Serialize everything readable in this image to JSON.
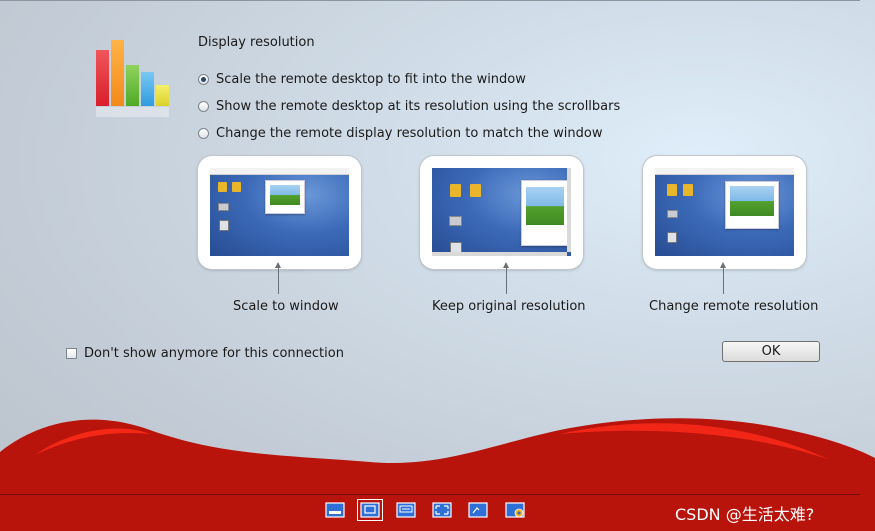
{
  "heading": "Display resolution",
  "options": [
    {
      "label": "Scale the remote desktop to fit into the window",
      "selected": true
    },
    {
      "label": "Show the remote desktop at its resolution using the scrollbars",
      "selected": false
    },
    {
      "label": "Change the remote display resolution to match the window",
      "selected": false
    }
  ],
  "previews": [
    {
      "caption": "Scale to window"
    },
    {
      "caption": "Keep original resolution"
    },
    {
      "caption": "Change remote resolution"
    }
  ],
  "checkbox": {
    "label": "Don't show anymore for this connection",
    "checked": false
  },
  "ok_label": "OK",
  "toolbar": [
    "window-icon",
    "scale-to-window-icon",
    "keyboard-icon",
    "fullscreen-icon",
    "desktop-icon",
    "settings-icon"
  ],
  "watermark": "CSDN @生活太难?",
  "colors": {
    "accent_red": "#b8140c",
    "selected_radio": "#28456b",
    "desktop_blue": "#3c6ab8"
  }
}
